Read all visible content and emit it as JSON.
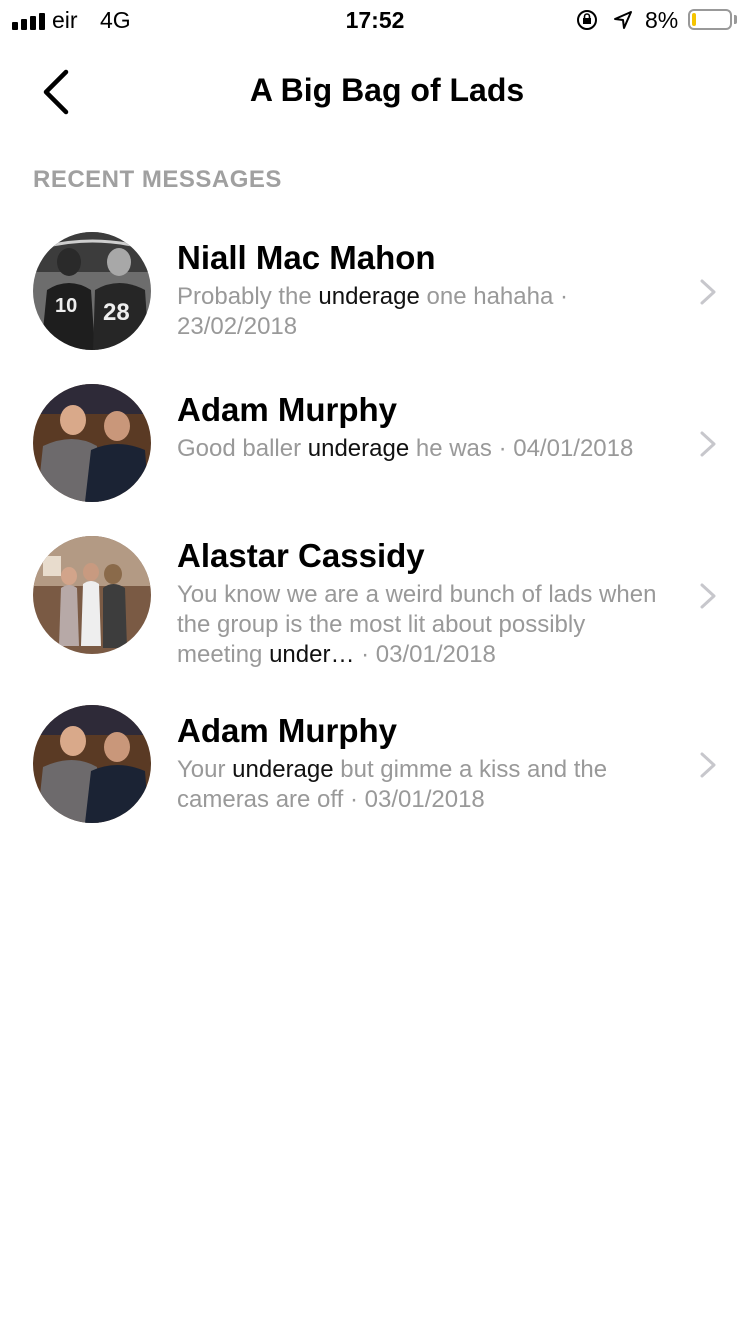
{
  "status_bar": {
    "carrier": "eir",
    "network": "4G",
    "time": "17:52",
    "battery_percent": "8%",
    "battery_level": 0.08,
    "battery_color": "#f5c400",
    "icons": [
      "signal-icon",
      "orientation-lock-icon",
      "location-icon",
      "battery-icon"
    ]
  },
  "header": {
    "title": "A Big Bag of Lads",
    "back_icon": "chevron-left-icon"
  },
  "section": {
    "title": "RECENT MESSAGES"
  },
  "messages": [
    {
      "name": "Niall Mac Mahon",
      "preview_before": "Probably the ",
      "keyword": "underage",
      "preview_after": " one hahaha",
      "date": " · 23/02/2018"
    },
    {
      "name": "Adam Murphy",
      "preview_before": "Good baller ",
      "keyword": "underage",
      "preview_after": " he was",
      "date": " · 04/01/2018"
    },
    {
      "name": "Alastar Cassidy",
      "preview_before": "You know we are a weird bunch of lads when the group is the most lit about possibly meeting ",
      "keyword": "under…",
      "preview_after": "",
      "date": " · 03/01/2018"
    },
    {
      "name": "Adam Murphy",
      "preview_before": "Your ",
      "keyword": "underage",
      "preview_after": " but gimme a kiss and the cameras are off",
      "date": " · 03/01/2018"
    }
  ],
  "colors": {
    "highlight_text": "#111111",
    "muted_text": "#999999",
    "section_header": "#a0a0a0",
    "chevron": "#c7c7cc"
  }
}
